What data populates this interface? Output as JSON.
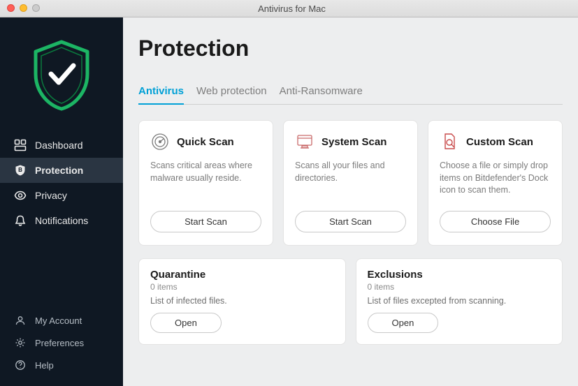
{
  "window": {
    "title": "Antivirus for Mac"
  },
  "sidebar": {
    "items": [
      {
        "label": "Dashboard"
      },
      {
        "label": "Protection"
      },
      {
        "label": "Privacy"
      },
      {
        "label": "Notifications"
      }
    ],
    "active": 1,
    "bottom": [
      {
        "label": "My Account"
      },
      {
        "label": "Preferences"
      },
      {
        "label": "Help"
      }
    ]
  },
  "page": {
    "title": "Protection"
  },
  "tabs": {
    "items": [
      {
        "label": "Antivirus"
      },
      {
        "label": "Web protection"
      },
      {
        "label": "Anti-Ransomware"
      }
    ],
    "active": 0
  },
  "scan_cards": [
    {
      "title": "Quick Scan",
      "desc": "Scans critical areas where malware usually reside.",
      "button": "Start Scan"
    },
    {
      "title": "System Scan",
      "desc": "Scans all your files and directories.",
      "button": "Start Scan"
    },
    {
      "title": "Custom Scan",
      "desc": "Choose a file or simply drop items on Bitdefender's Dock icon to scan them.",
      "button": "Choose File"
    }
  ],
  "lower_cards": [
    {
      "title": "Quarantine",
      "sub": "0 items",
      "desc": "List of infected files.",
      "button": "Open"
    },
    {
      "title": "Exclusions",
      "sub": "0 items",
      "desc": "List of files excepted from scanning.",
      "button": "Open"
    }
  ],
  "colors": {
    "accent": "#00a0d6",
    "logo_green": "#1cb564",
    "sidebar_bg": "#0f1823"
  }
}
